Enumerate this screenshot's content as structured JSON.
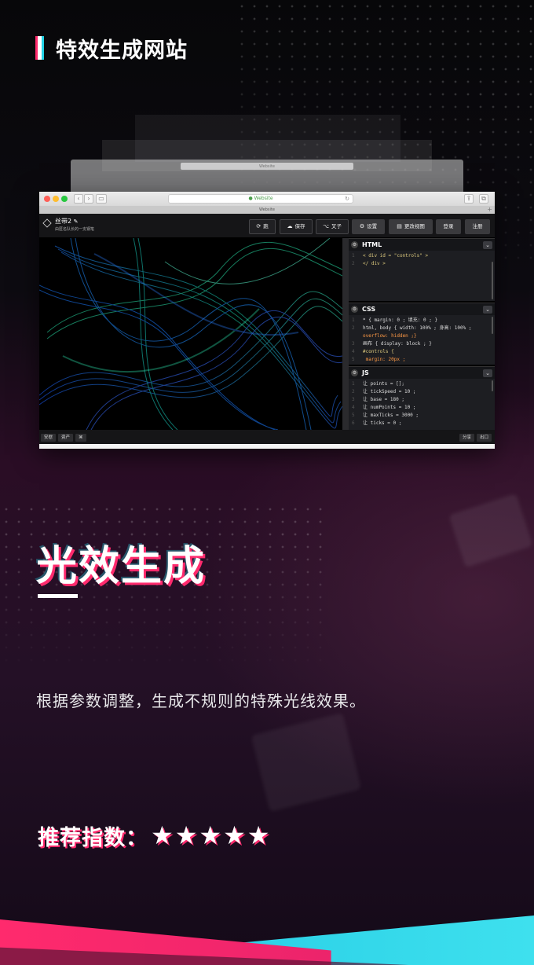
{
  "header": {
    "title": "特效生成网站"
  },
  "browser": {
    "ghost_title": "Website",
    "url": "Website",
    "tab_title": "Website"
  },
  "editor": {
    "pen_title": "丝带2",
    "pen_subtitle": "由匿名队长的一支钢笔",
    "buttons": {
      "run": "跑",
      "save": "保存",
      "fork": "叉子",
      "settings": "设置",
      "change_view": "更改视图",
      "login": "登录",
      "signup": "注册"
    },
    "panels": {
      "html": {
        "title": "HTML",
        "lines": [
          [
            "1",
            "< div  id = \"controls\" >"
          ],
          [
            "2",
            "</ div >"
          ]
        ]
      },
      "css": {
        "title": "CSS",
        "lines": [
          [
            "1",
            "* { margin: 0 ; 填充: 0 ; }"
          ],
          [
            "2",
            "html, body { width: 100% ; 身高: 100% ;"
          ],
          [
            "",
            "overflow: hidden ;}"
          ],
          [
            "3",
            "画布 { display: block ; }"
          ],
          [
            "4",
            "#controls {"
          ],
          [
            "5",
            "  margin: 20px ;"
          ]
        ]
      },
      "js": {
        "title": "JS",
        "lines": [
          [
            "1",
            "让 points  = [];"
          ],
          [
            "2",
            "让 tickSpeed  =  10 ;"
          ],
          [
            "3",
            "让 base  =  180 ;"
          ],
          [
            "4",
            "让 numPoints  =  10 ;"
          ],
          [
            "5",
            "让 maxTicks  =  3000 ;"
          ],
          [
            "6",
            "让 ticks  =  0 ;"
          ]
        ]
      }
    },
    "bottom": {
      "console": "安慰",
      "assets": "资产",
      "shortcut": "⌘",
      "share": "分享",
      "export": "出口"
    }
  },
  "feature": {
    "title": "光效生成",
    "description": "根据参数调整，生成不规则的特殊光线效果。",
    "rating_label": "推荐指数：",
    "rating_stars": "★★★★★",
    "rating_value": 5
  },
  "colors": {
    "accent_pink": "#ff2a6d",
    "accent_cyan": "#22d3e6"
  }
}
